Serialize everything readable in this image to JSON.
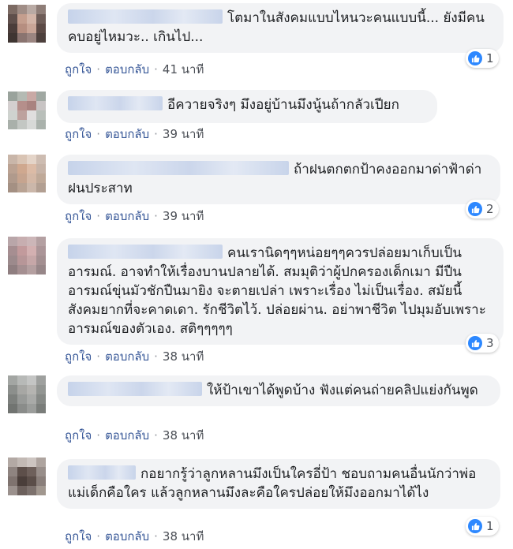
{
  "comments": [
    {
      "text": "โตมาในสังคมแบบไหนวะคนแบบนี้... ยังมีคนคบอยู่ไหมวะ.. เกินไป...",
      "like_label": "ถูกใจ",
      "reply_label": "ตอบกลับ",
      "time": "41 นาที",
      "reaction_count": "1"
    },
    {
      "text": "อีควายจริงๆ มึงอยู่บ้านมึงนู้นถ้ากลัวเปียก",
      "like_label": "ถูกใจ",
      "reply_label": "ตอบกลับ",
      "time": "39 นาที",
      "reaction_count": ""
    },
    {
      "text": "ถ้าฝนตกตกป้าคงออกมาด่าฟ้าด่าฝนประสาท",
      "like_label": "ถูกใจ",
      "reply_label": "ตอบกลับ",
      "time": "39 นาที",
      "reaction_count": "2"
    },
    {
      "text": "คนเรานิดๆๆหน่อยๆๆควรปล่อยมาเก็บเป็นอารมณ์. อาจทำให้เรื่องบานปลายได้. สมมุติว่าผู้ปกครองเด็กเมา มีปืนอารมณ์ขุ่นมัวชักปืนมายิง จะตายเปล่า เพราะเรื่อง ไม่เป็นเรื่อง. สมัยนี้สังคมยากที่จะคาดเดา. รักชีวิตไว้. ปล่อยผ่าน. อย่าพาชีวิต ไปมุมอับเพราะ อารมณ์ของตัวเอง. สติๆๆๆๆๆ",
      "like_label": "ถูกใจ",
      "reply_label": "ตอบกลับ",
      "time": "38 นาที",
      "reaction_count": "3"
    },
    {
      "text": "ให้ป้าเขาได้พูดบ้าง ฟังแต่คนถ่ายคลิปแย่งกันพูด",
      "like_label": "ถูกใจ",
      "reply_label": "ตอบกลับ",
      "time": "38 นาที",
      "reaction_count": ""
    },
    {
      "text": "กอยากรู้ว่าลูกหลานมึงเป็นใครอี่ป้า ชอบถามคนอื่นนักว่าพ่อแม่เด็กคือใคร แล้วลูกหลานมึงละคือใครปล่อยให้มึงออกมาได้ไง",
      "like_label": "ถูกใจ",
      "reply_label": "ตอบกลับ",
      "time": "38 นาที",
      "reaction_count": "1"
    }
  ],
  "colors": {
    "bubble": "#f2f3f5",
    "link": "#385898",
    "like": "#2d88ff"
  }
}
